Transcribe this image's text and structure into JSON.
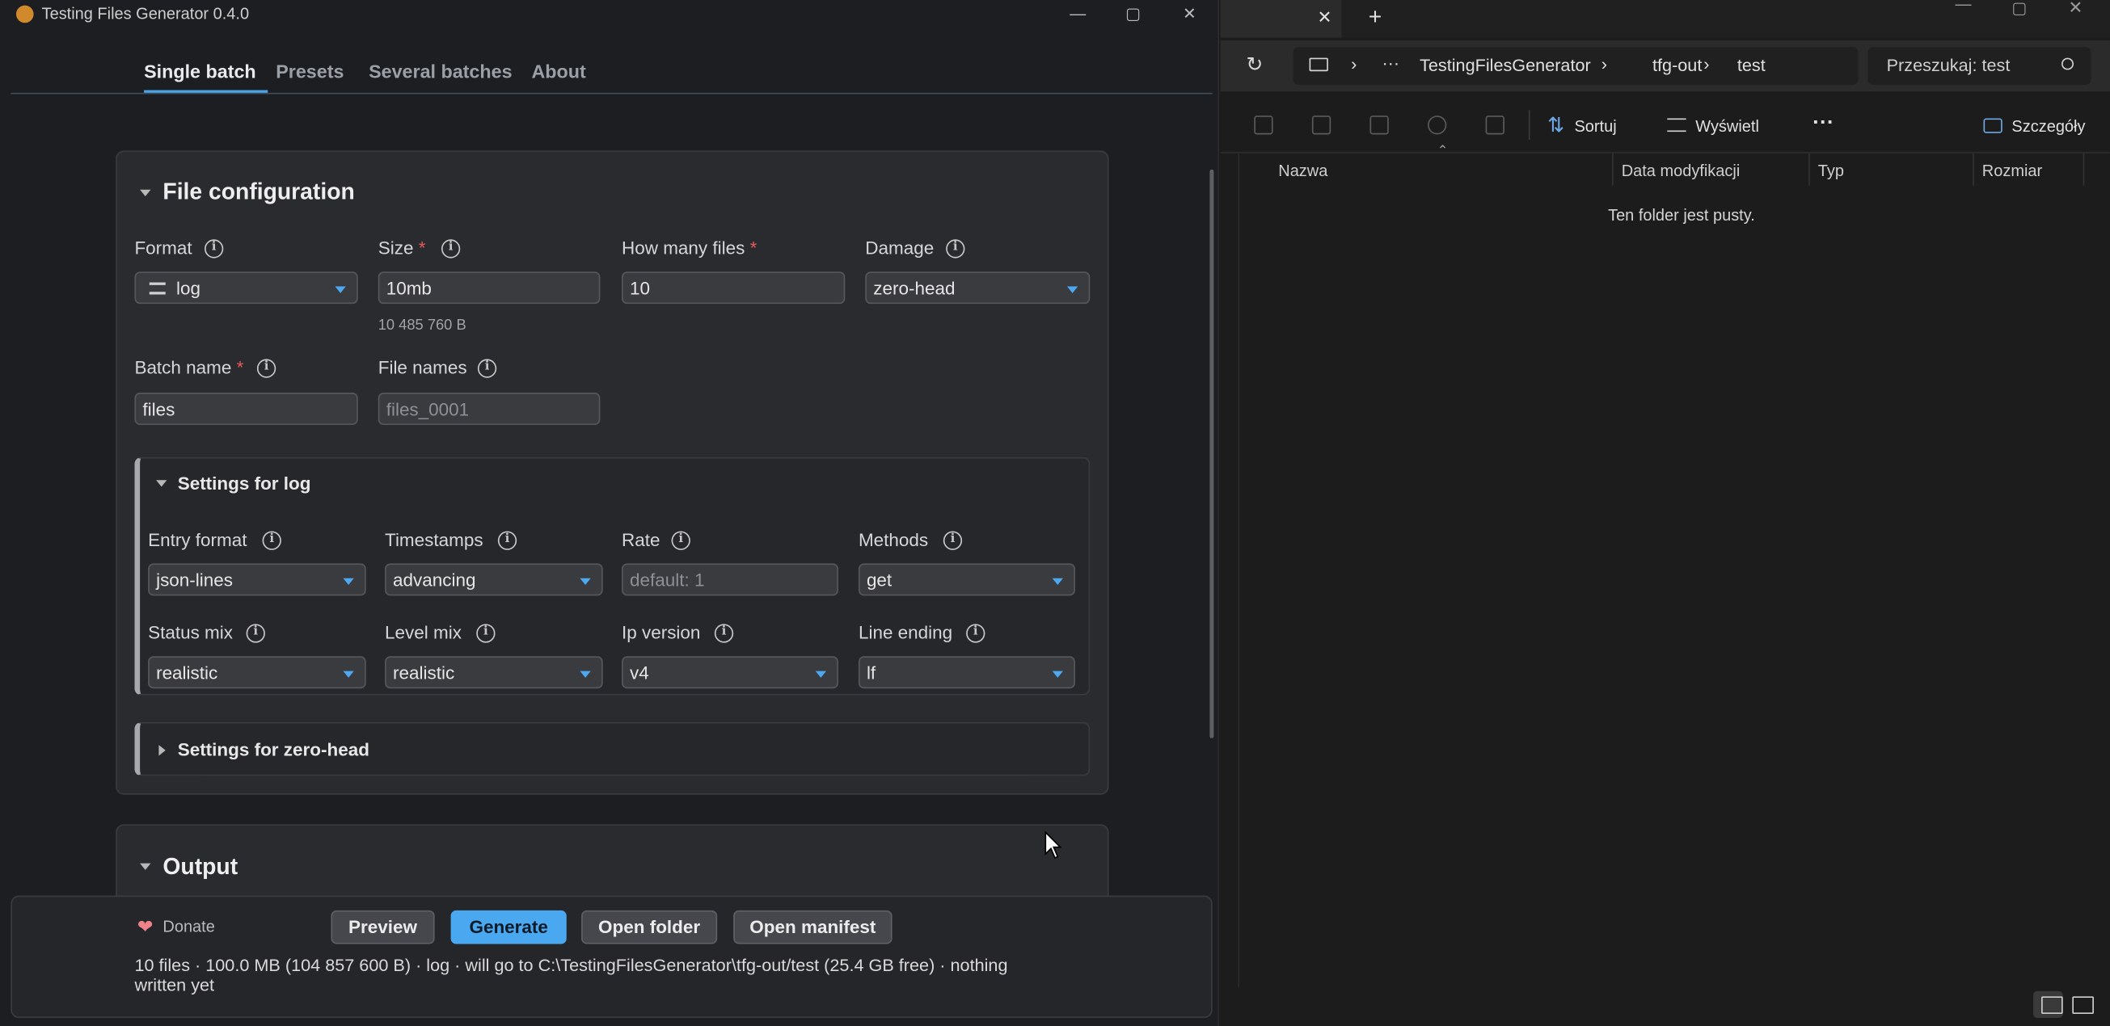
{
  "app": {
    "title": "Testing Files Generator 0.4.0",
    "window_controls": {
      "minimize": "—",
      "maximize": "▢",
      "close": "✕"
    },
    "tabs": [
      "Single batch",
      "Presets",
      "Several batches",
      "About"
    ],
    "active_tab": "Single batch",
    "file_config": {
      "title": "File configuration",
      "format": {
        "label": "Format",
        "value": "log"
      },
      "size": {
        "label": "Size",
        "value": "10mb",
        "hint": "10 485 760 B"
      },
      "how_many": {
        "label": "How many files",
        "value": "10"
      },
      "damage": {
        "label": "Damage",
        "value": "zero-head"
      },
      "batch_name": {
        "label": "Batch name",
        "value": "files"
      },
      "file_names": {
        "label": "File names",
        "placeholder": "files_0001"
      },
      "required_mark": "*"
    },
    "settings_log": {
      "title": "Settings for log",
      "entry_format": {
        "label": "Entry format",
        "value": "json-lines"
      },
      "timestamps": {
        "label": "Timestamps",
        "value": "advancing"
      },
      "rate": {
        "label": "Rate",
        "placeholder": "default: 1"
      },
      "methods": {
        "label": "Methods",
        "value": "get"
      },
      "status_mix": {
        "label": "Status mix",
        "value": "realistic"
      },
      "level_mix": {
        "label": "Level mix",
        "value": "realistic"
      },
      "ip_version": {
        "label": "Ip version",
        "value": "v4"
      },
      "line_ending": {
        "label": "Line ending",
        "value": "lf"
      }
    },
    "settings_zero_head": {
      "title": "Settings for zero-head"
    },
    "output": {
      "title": "Output"
    },
    "footer": {
      "donate": "Donate",
      "buttons": {
        "preview": "Preview",
        "generate": "Generate",
        "open_folder": "Open folder",
        "open_manifest": "Open manifest"
      },
      "status_line1": "10 files · 100.0 MB (104 857 600 B) · log · will go to C:\\TestingFilesGenerator\\tfg-out/test (25.4 GB free) · nothing",
      "status_line2": "written yet"
    },
    "colors": {
      "accent": "#4aa8f0",
      "required": "#e85a5a",
      "heart": "#f0828a"
    }
  },
  "explorer": {
    "tab_close": "✕",
    "tab_add": "+",
    "breadcrumb": [
      "TestingFilesGenerator",
      "tfg-out",
      "test"
    ],
    "breadcrumb_more": "···",
    "search_placeholder": "Przeszukaj: test",
    "toolbar": {
      "sort": "Sortuj",
      "view": "Wyświetl",
      "more": "···",
      "details": "Szczegóły"
    },
    "columns": [
      "Nazwa",
      "Data modyfikacji",
      "Typ",
      "Rozmiar"
    ],
    "empty_message": "Ten folder jest pusty."
  }
}
